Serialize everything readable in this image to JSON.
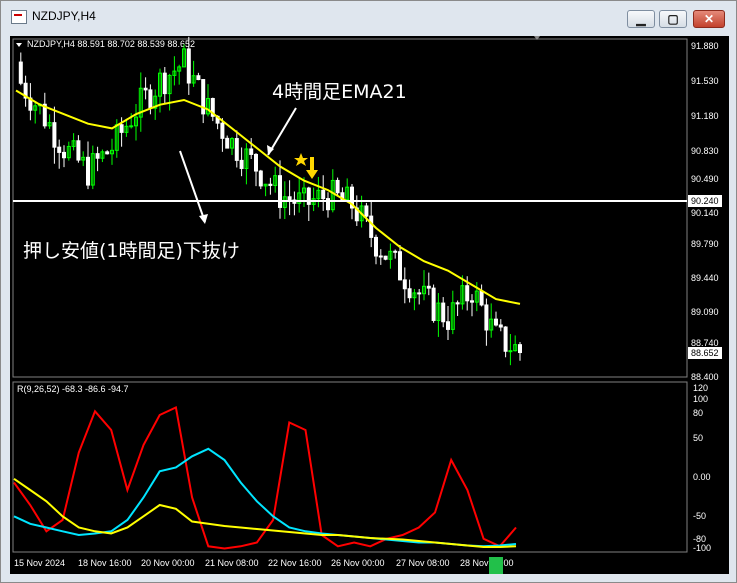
{
  "window": {
    "title": "NZDJPY,H4"
  },
  "main_chart": {
    "info": "NZDJPY,H4  88.591 88.702 88.539 88.652",
    "price_labels": [
      "91.880",
      "91.530",
      "91.180",
      "90.830",
      "90.490",
      "90.140",
      "89.790",
      "89.440",
      "89.090",
      "88.740",
      "88.400"
    ],
    "hline_label": "90.240",
    "current_price": "88.652",
    "annotation_ema": "4時間足EMA21",
    "annotation_break": "押し安値(1時間足)下抜け",
    "colors": {
      "bull": "#00ff00",
      "bear": "#ffffff",
      "ema": "#ffff00",
      "arrow": "#ffd700"
    }
  },
  "indicator": {
    "info": "R(9,26,52) -68.3 -86.6 -94.7",
    "levels": [
      "120",
      "100",
      "80",
      "50",
      "0.00",
      "-50",
      "-80",
      "-100"
    ],
    "colors": {
      "fast": "#ff0000",
      "mid": "#00e5ff",
      "slow": "#ffff00"
    }
  },
  "time_axis": [
    "15 Nov 2024",
    "18 Nov 16:00",
    "20 Nov 00:00",
    "21 Nov 08:00",
    "22 Nov 16:00",
    "26 Nov 00:00",
    "27 Nov 08:00",
    "28 Nov 16:00"
  ],
  "chart_data": {
    "type": "line",
    "title": "NZDJPY,H4",
    "series": [
      {
        "name": "NZDJPY",
        "values_approx_close": [
          91.55,
          91.2,
          90.8,
          90.55,
          90.8,
          91.2,
          91.5,
          91.7,
          91.2,
          90.85,
          90.6,
          90.3,
          90.2,
          90.3,
          90.2,
          89.8,
          89.5,
          89.2,
          89.0,
          89.3,
          88.8,
          88.65
        ]
      },
      {
        "name": "EMA21",
        "values_approx": [
          91.4,
          91.25,
          91.15,
          91.05,
          91.0,
          91.15,
          91.25,
          91.3,
          91.2,
          91.0,
          90.8,
          90.6,
          90.45,
          90.35,
          90.2,
          89.95,
          89.75,
          89.6,
          89.5,
          89.35,
          89.2,
          89.15
        ]
      }
    ],
    "ylim": [
      88.4,
      91.88
    ]
  }
}
